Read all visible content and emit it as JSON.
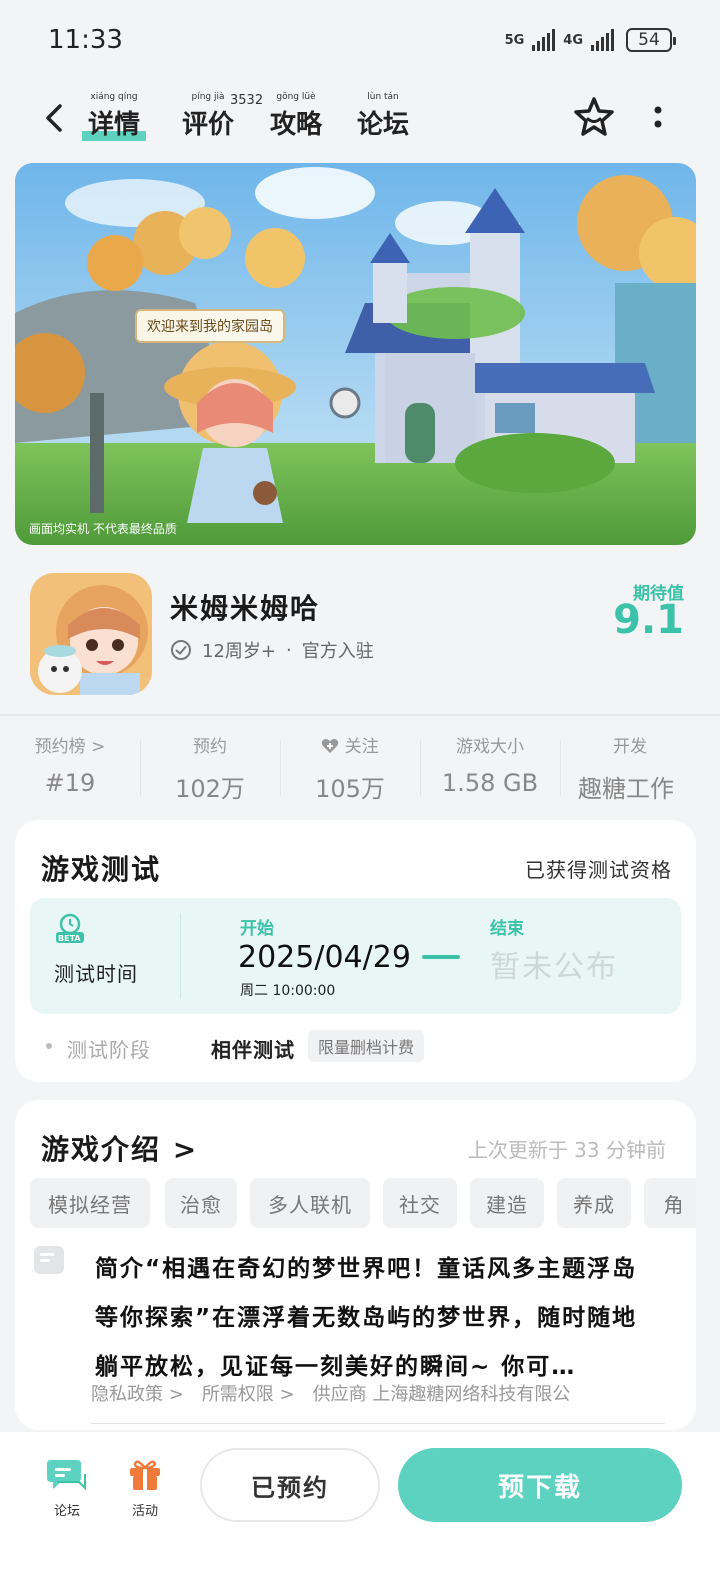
{
  "status_bar": {
    "time": "11:33",
    "net1": "5G",
    "net2": "4G",
    "battery": "54"
  },
  "nav": {
    "tabs": [
      {
        "label": "详情",
        "pinyin": "xiáng qíng"
      },
      {
        "label": "评价",
        "pinyin": "píng jià"
      },
      {
        "label": "攻略",
        "pinyin": "gōng lüè"
      },
      {
        "label": "论坛",
        "pinyin": "lùn tán"
      }
    ],
    "review_count": "3532"
  },
  "banner": {
    "welcome": "欢迎来到我的家园岛",
    "caption": "画面均实机 不代表最终品质"
  },
  "app": {
    "name": "米姆米姆哈",
    "age": "12周岁+",
    "official": "官方入驻",
    "score_label": "期待值",
    "score": "9.1"
  },
  "stats": [
    {
      "label": "预约榜 >",
      "value": "#19"
    },
    {
      "label": "预约",
      "value": "102万"
    },
    {
      "label": "关注",
      "value": "105万"
    },
    {
      "label": "游戏大小",
      "value": "1.58 GB"
    },
    {
      "label": "开发",
      "value": "趣糖工作"
    }
  ],
  "test": {
    "title": "游戏测试",
    "qualified": "已获得测试资格",
    "time_label": "测试时间",
    "badge": "BETA",
    "start_label": "开始",
    "start_date": "2025/04/29",
    "start_time": "周二  10:00:00",
    "end_label": "结束",
    "end_value": "暂未公布",
    "phase_label": "测试阶段",
    "phase_type": "相伴测试",
    "phase_tag": "限量删档计费"
  },
  "intro": {
    "title": "游戏介绍 >",
    "updated": "上次更新于 33 分钟前",
    "tags": [
      "模拟经营",
      "治愈",
      "多人联机",
      "社交",
      "建造",
      "养成",
      "角"
    ],
    "description": "简介“相遇在奇幻的梦世界吧！童话风多主题浮岛等你探索”在漂浮着无数岛屿的梦世界，随时随地躺平放松，见证每一刻美好的瞬间~ 你可…",
    "links": [
      "隐私政策 >",
      "所需权限 >",
      "供应商 上海趣糖网络科技有限公"
    ]
  },
  "bottom": {
    "forum_label": "论坛",
    "activity_label": "活动",
    "reserved_label": "已预约",
    "download_label": "预下载"
  },
  "colors": {
    "accent": "#5ed2c0",
    "accent_text": "#3cc2a9"
  }
}
